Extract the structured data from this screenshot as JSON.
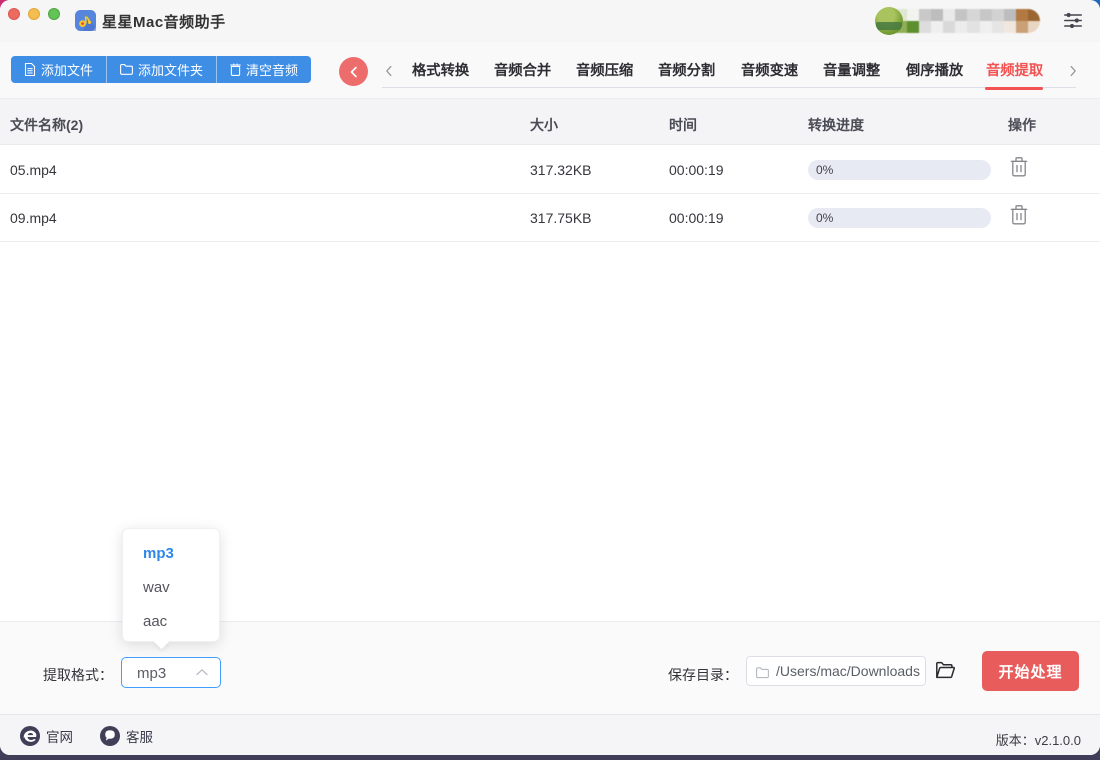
{
  "window": {
    "title": "星星Mac音频助手"
  },
  "titlebar": {
    "traffic_lights": [
      "close",
      "minimize",
      "maximize"
    ],
    "app_icon": "music-note-app-icon",
    "settings_icon": "sliders-icon"
  },
  "toolbar": {
    "add_file": "添加文件",
    "add_folder": "添加文件夹",
    "clear_audio": "清空音频"
  },
  "tabs": {
    "items": [
      {
        "label": "格式转换",
        "active": false
      },
      {
        "label": "音频合并",
        "active": false
      },
      {
        "label": "音频压缩",
        "active": false
      },
      {
        "label": "音频分割",
        "active": false
      },
      {
        "label": "音频变速",
        "active": false
      },
      {
        "label": "音量调整",
        "active": false
      },
      {
        "label": "倒序播放",
        "active": false
      },
      {
        "label": "音频提取",
        "active": true
      }
    ],
    "active_color": "#f25352"
  },
  "table": {
    "columns": {
      "name": "文件名称(2)",
      "size": "大小",
      "time": "时间",
      "progress": "转换进度",
      "action": "操作"
    },
    "rows": [
      {
        "name": "05.mp4",
        "size": "317.32KB",
        "time": "00:00:19",
        "progress": "0%"
      },
      {
        "name": "09.mp4",
        "size": "317.75KB",
        "time": "00:00:19",
        "progress": "0%"
      }
    ]
  },
  "format_dropdown": {
    "options": [
      {
        "label": "mp3",
        "selected": true
      },
      {
        "label": "wav",
        "selected": false
      },
      {
        "label": "aac",
        "selected": false
      }
    ]
  },
  "controls": {
    "format_label": "提取格式：",
    "format_value": "mp3",
    "save_dir_label": "保存目录：",
    "save_dir_value": "/Users/mac/Downloads",
    "start_button": "开始处理"
  },
  "footer": {
    "website": "官网",
    "support": "客服",
    "version": "版本：v2.1.0.0"
  },
  "colors": {
    "accent_blue": "#3e8ee6",
    "accent_red": "#ed6d6d",
    "active_tab_red": "#f25352",
    "start_button_red": "#e85c5c",
    "progress_track": "#e8eaf3"
  }
}
